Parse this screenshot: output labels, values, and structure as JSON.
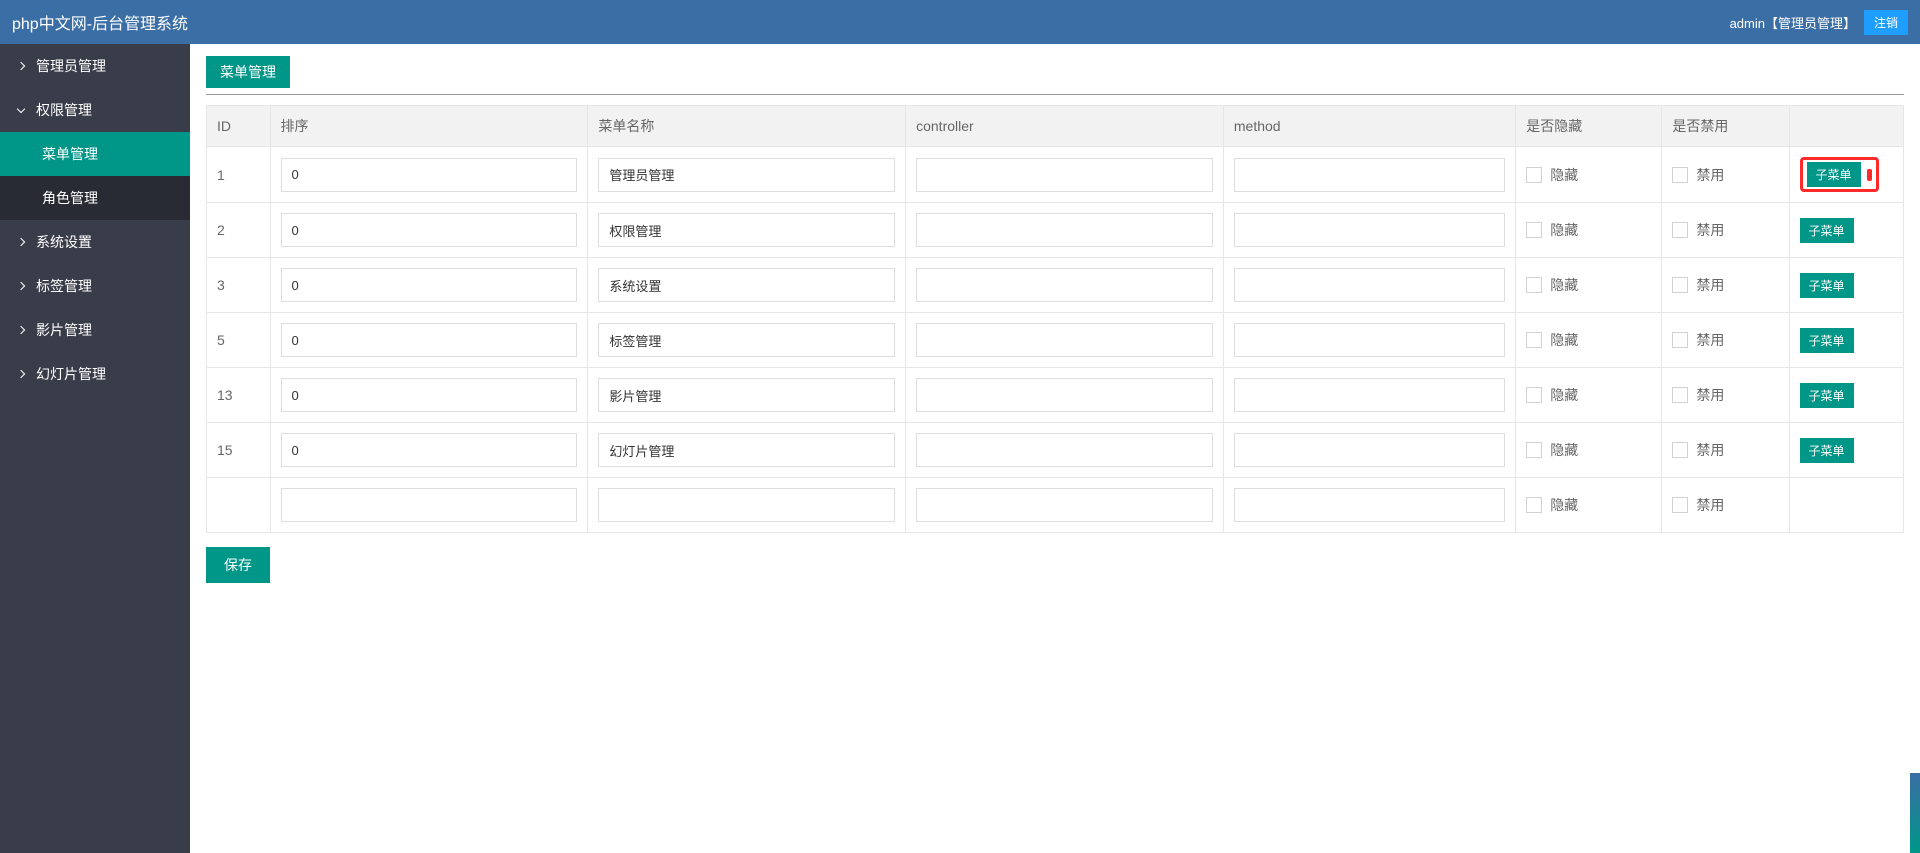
{
  "header": {
    "title": "php中文网-后台管理系统",
    "user": "admin【管理员管理】",
    "logout": "注销"
  },
  "sidebar": {
    "items": [
      {
        "label": "管理员管理",
        "expanded": false,
        "level": 0
      },
      {
        "label": "权限管理",
        "expanded": true,
        "level": 0
      },
      {
        "label": "菜单管理",
        "level": 1,
        "active": true
      },
      {
        "label": "角色管理",
        "level": 1
      },
      {
        "label": "系统设置",
        "expanded": false,
        "level": 0
      },
      {
        "label": "标签管理",
        "expanded": false,
        "level": 0
      },
      {
        "label": "影片管理",
        "expanded": false,
        "level": 0
      },
      {
        "label": "幻灯片管理",
        "expanded": false,
        "level": 0
      }
    ]
  },
  "page": {
    "title": "菜单管理",
    "save_label": "保存"
  },
  "table": {
    "headers": {
      "id": "ID",
      "sort": "排序",
      "name": "菜单名称",
      "controller": "controller",
      "method": "method",
      "hide": "是否隐藏",
      "disable": "是否禁用"
    },
    "labels": {
      "hide": "隐藏",
      "disable": "禁用",
      "submenu": "子菜单"
    },
    "rows": [
      {
        "id": "1",
        "sort": "0",
        "name": "管理员管理",
        "controller": "",
        "method": "",
        "highlighted": true
      },
      {
        "id": "2",
        "sort": "0",
        "name": "权限管理",
        "controller": "",
        "method": ""
      },
      {
        "id": "3",
        "sort": "0",
        "name": "系统设置",
        "controller": "",
        "method": ""
      },
      {
        "id": "5",
        "sort": "0",
        "name": "标签管理",
        "controller": "",
        "method": ""
      },
      {
        "id": "13",
        "sort": "0",
        "name": "影片管理",
        "controller": "",
        "method": ""
      },
      {
        "id": "15",
        "sort": "0",
        "name": "幻灯片管理",
        "controller": "",
        "method": ""
      },
      {
        "id": "",
        "sort": "",
        "name": "",
        "controller": "",
        "method": "",
        "empty": true
      }
    ]
  }
}
